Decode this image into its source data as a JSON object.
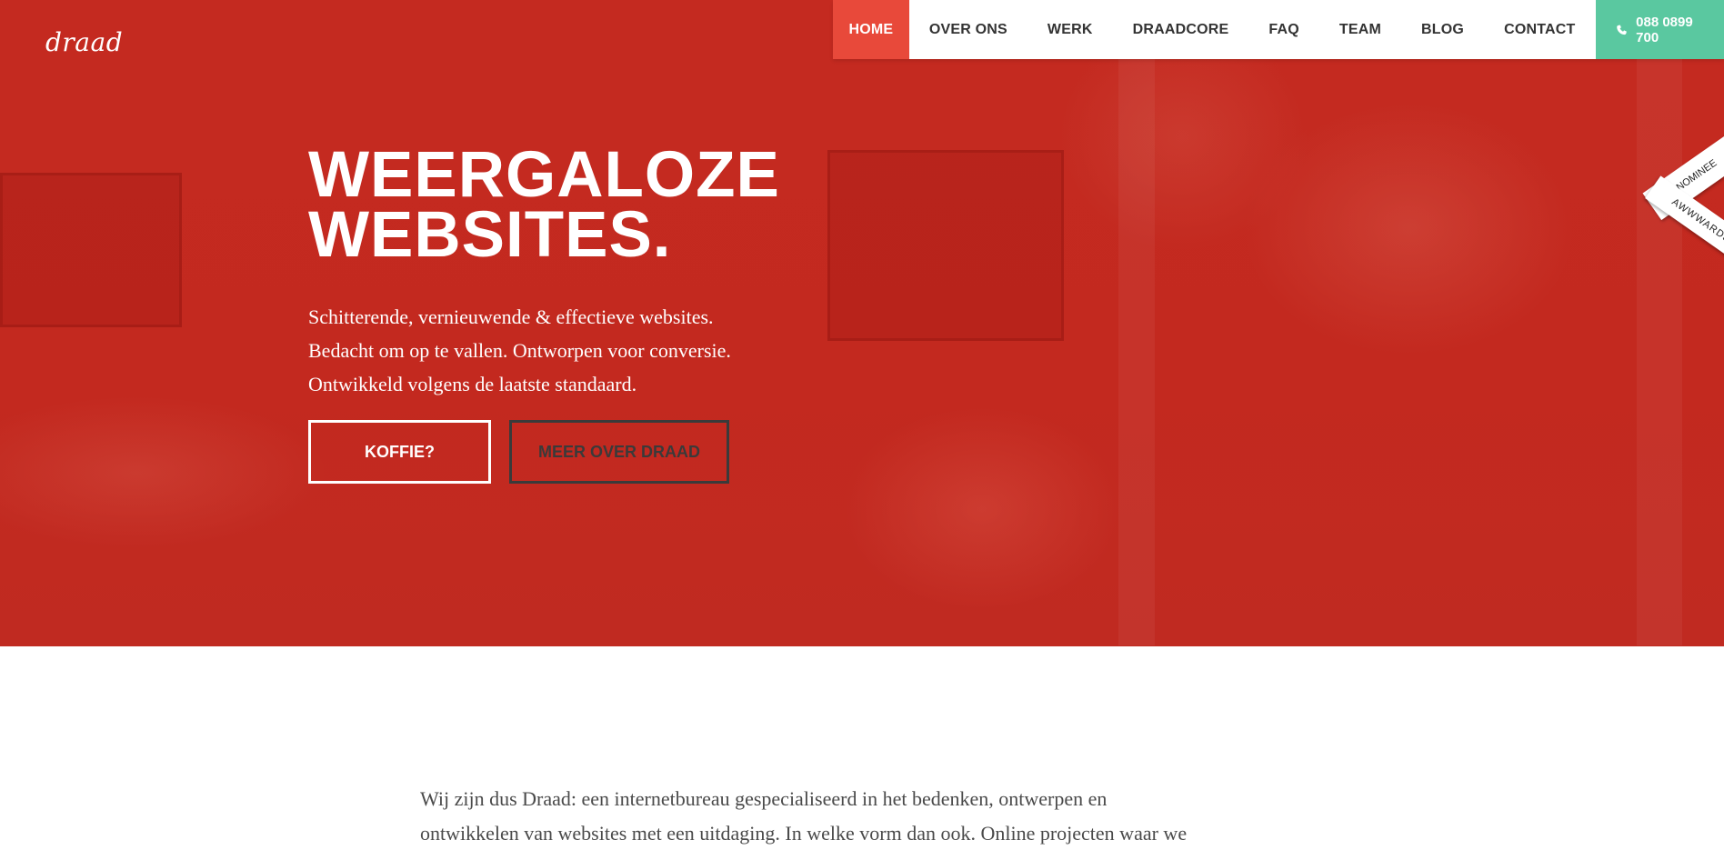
{
  "brand": {
    "logo_text": "draad"
  },
  "nav": {
    "items": [
      {
        "label": "HOME",
        "active": true
      },
      {
        "label": "OVER ONS",
        "active": false
      },
      {
        "label": "WERK",
        "active": false
      },
      {
        "label": "DRAADCORE",
        "active": false
      },
      {
        "label": "FAQ",
        "active": false
      },
      {
        "label": "TEAM",
        "active": false
      },
      {
        "label": "BLOG",
        "active": false
      },
      {
        "label": "CONTACT",
        "active": false
      }
    ],
    "phone": "088 0899 700",
    "phone_icon": "phone-icon"
  },
  "ribbon": {
    "top_text": "NOMINEE",
    "bottom_text": "AWWWARDS"
  },
  "hero": {
    "headline_line1": "WEERGALOZE",
    "headline_line2": "WEBSITES.",
    "sub_line1": "Schitterende, vernieuwende & effectieve websites.",
    "sub_line2": "Bedacht om op te vallen. Ontworpen voor conversie.",
    "sub_line3": "Ontwikkeld volgens de laatste standaard.",
    "cta_primary": "KOFFIE?",
    "cta_secondary": "MEER OVER DRAAD"
  },
  "intro": {
    "line1": "Wij zijn dus Draad: een internetbureau gespecialiseerd in het bedenken, ontwerpen en",
    "line2": "ontwikkelen van websites met een uitdaging. In welke vorm dan ook. Online projecten waar we",
    "line3": ""
  },
  "colors": {
    "hero_red": "#c62c22",
    "nav_active": "#e8493a",
    "phone_green": "#5ac8a0",
    "nav_text": "#333333"
  }
}
